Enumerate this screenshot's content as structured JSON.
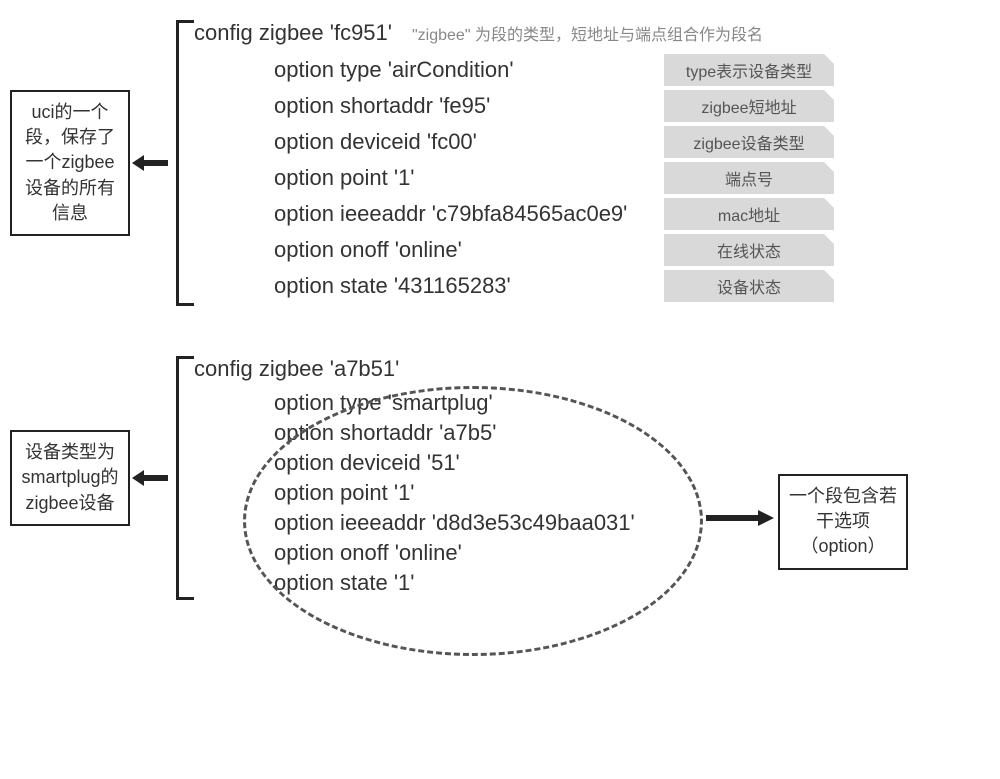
{
  "block1": {
    "callout": "uci的一个段，保存了一个zigbee设备的所有信息",
    "header": "config zigbee 'fc951'",
    "headerNote": "\"zigbee\" 为段的类型，短地址与端点组合作为段名",
    "opts": [
      {
        "code": "option type 'airCondition'",
        "tag": "type表示设备类型"
      },
      {
        "code": "option shortaddr 'fe95'",
        "tag": "zigbee短地址"
      },
      {
        "code": "option deviceid 'fc00'",
        "tag": "zigbee设备类型"
      },
      {
        "code": "option point '1'",
        "tag": "端点号"
      },
      {
        "code": "option ieeeaddr 'c79bfa84565ac0e9'",
        "tag": "mac地址"
      },
      {
        "code": "option onoff 'online'",
        "tag": "在线状态"
      },
      {
        "code": "option state '431165283'",
        "tag": "设备状态"
      }
    ]
  },
  "block2": {
    "callout": "设备类型为smartplug的zigbee设备",
    "header": "config zigbee 'a7b51'",
    "opts": [
      {
        "code": "option type 'smartplug'"
      },
      {
        "code": "option shortaddr 'a7b5'"
      },
      {
        "code": "option deviceid '51'"
      },
      {
        "code": "option point '1'"
      },
      {
        "code": "option ieeeaddr 'd8d3e53c49baa031'"
      },
      {
        "code": "option onoff 'online'"
      },
      {
        "code": "option state '1'"
      }
    ],
    "rightCallout": "一个段包含若干选项（option）"
  }
}
